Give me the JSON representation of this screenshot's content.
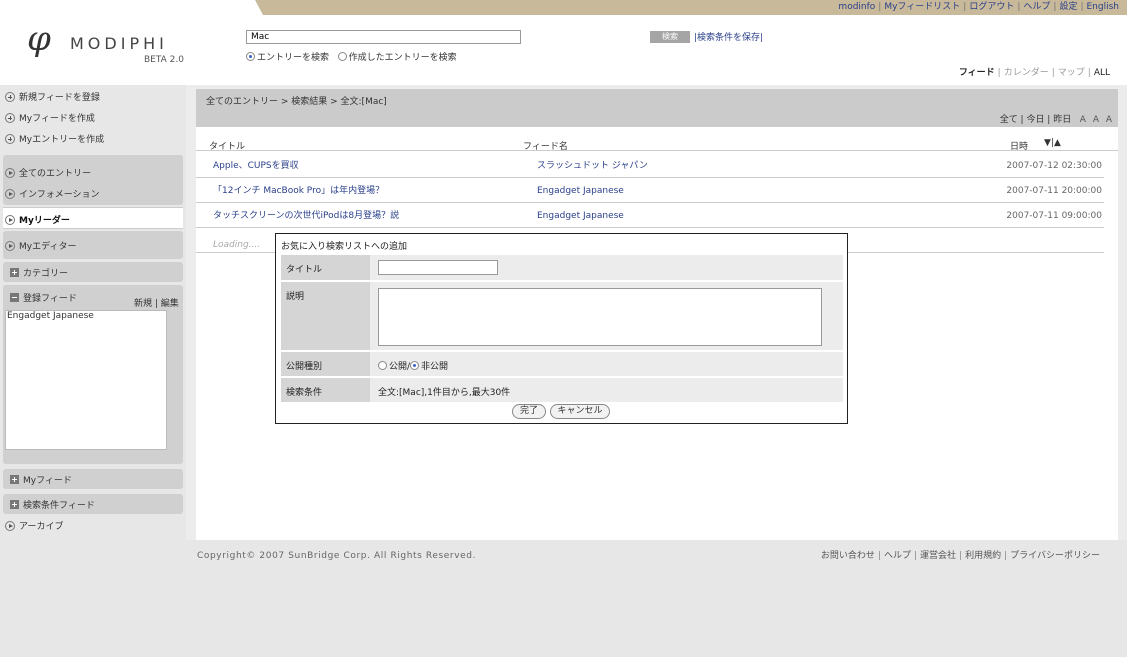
{
  "toplinks": [
    "modinfo",
    "Myフィードリスト",
    "ログアウト",
    "ヘルプ",
    "設定",
    "English"
  ],
  "logo": {
    "symbol": "φ",
    "name": "MODIPHI",
    "beta": "BETA 2.0"
  },
  "search": {
    "value": "Mac",
    "option_entries": "エントリーを検索",
    "option_created": "作成したエントリーを検索",
    "button": "検索",
    "save_link": "|検索条件を保存|"
  },
  "viewtabs": {
    "feed": "フィード",
    "calendar": "カレンダー",
    "map": "マップ",
    "all": "ALL"
  },
  "sidebar": {
    "register_feed": "新規フィードを登録",
    "create_myfeed": "Myフィードを作成",
    "create_myentry": "Myエントリーを作成",
    "all_entries": "全てのエントリー",
    "information": "インフォメーション",
    "myreader": "Myリーダー",
    "myeditor": "Myエディター",
    "category": "カテゴリー",
    "registered_feed": "登録フィード",
    "new_edit": "新規 | 編集",
    "feed_item": "Engadget Japanese",
    "myfeed": "Myフィード",
    "search_feed": "検索条件フィード",
    "archive": "アーカイブ"
  },
  "main": {
    "breadcrumb": "全てのエントリー > 検索結果 > 全文:[Mac]",
    "date_filter": "全て | 今日 | 昨日",
    "font_sizes": "A A A",
    "col_title": "タイトル",
    "col_feed": "フィード名",
    "col_date": "日時",
    "sort": "▼|▲",
    "loading": "Loading....",
    "rows": [
      {
        "title": "Apple、CUPSを買収",
        "feed": "スラッシュドット ジャパン",
        "date": "2007-07-12 02:30:00"
      },
      {
        "title": "「12インチ MacBook Pro」は年内登場？",
        "feed": "Engadget Japanese",
        "date": "2007-07-11 20:00:00"
      },
      {
        "title": "タッチスクリーンの次世代iPodは8月登場？説",
        "feed": "Engadget Japanese",
        "date": "2007-07-11 09:00:00"
      }
    ]
  },
  "dialog": {
    "title": "お気に入り検索リストへの追加",
    "label_title": "タイトル",
    "label_desc": "説明",
    "label_public": "公開種別",
    "public": "公開/",
    "private": "非公開",
    "label_condition": "検索条件",
    "condition": "全文:[Mac],1件目から,最大30件",
    "done": "完了",
    "cancel": "キャンセル"
  },
  "footer": {
    "copyright": "Copyright© 2007 SunBridge Corp. All Rights Reserved.",
    "links": [
      "お問い合わせ",
      "ヘルプ",
      "運営会社",
      "利用規約",
      "プライバシーポリシー"
    ]
  }
}
